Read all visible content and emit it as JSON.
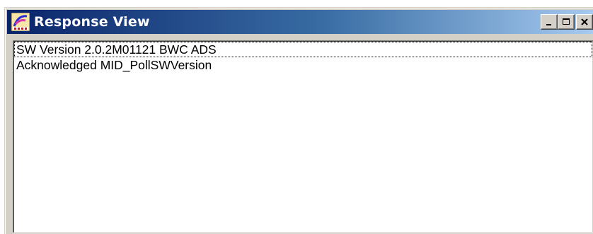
{
  "window": {
    "title": "Response View",
    "icon": "app-logo-icon"
  },
  "controls": {
    "minimize_icon": "minimize-icon",
    "maximize_icon": "maximize-icon",
    "close_icon": "close-icon"
  },
  "responses": [
    "SW Version 2.0.2M01121 BWC ADS",
    "Acknowledged MID_PollSWVersion"
  ],
  "colors": {
    "titlebar_start": "#0a246a",
    "titlebar_end": "#a6caf0",
    "window_face": "#d4d0c8"
  }
}
